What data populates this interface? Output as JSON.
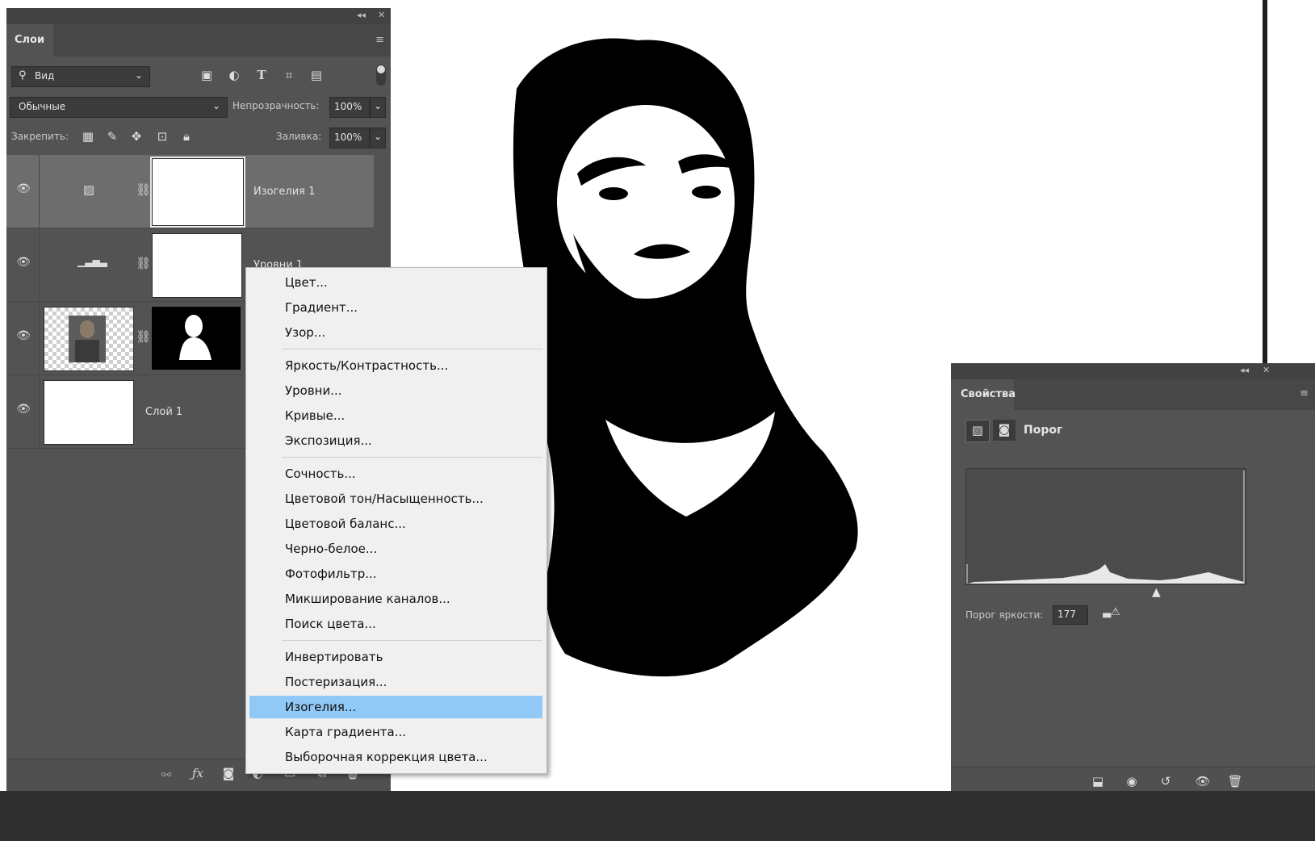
{
  "layers_panel": {
    "tab_label": "Слои",
    "filter_label": "Вид",
    "blend_mode": "Обычные",
    "opacity_label": "Непрозрачность:",
    "opacity_value": "100%",
    "lock_label": "Закрепить:",
    "fill_label": "Заливка:",
    "fill_value": "100%",
    "layers": [
      {
        "name": "Изогелия 1",
        "selected": true
      },
      {
        "name": "Уровни 1",
        "selected": false
      },
      {
        "name": "",
        "selected": false
      },
      {
        "name": "Слой 1",
        "selected": false
      }
    ]
  },
  "context_menu": {
    "groups": [
      [
        "Цвет...",
        "Градиент...",
        "Узор..."
      ],
      [
        "Яркость/Контрастность...",
        "Уровни...",
        "Кривые...",
        "Экспозиция..."
      ],
      [
        "Сочность...",
        "Цветовой тон/Насыщенность...",
        "Цветовой баланс...",
        "Черно-белое...",
        "Фотофильтр...",
        "Микширование каналов...",
        "Поиск цвета..."
      ],
      [
        "Инвертировать",
        "Постеризация...",
        "Изогелия...",
        "Карта градиента...",
        "Выборочная коррекция цвета..."
      ]
    ],
    "highlighted": "Изогелия...",
    "highlight_color": "#90c8f6"
  },
  "properties_panel": {
    "tab_label": "Свойства",
    "adjustment_name": "Порог",
    "threshold_label": "Порог яркости:",
    "threshold_value": "177"
  },
  "colors": {
    "panel_bg": "#535353",
    "panel_dark": "#424242",
    "canvas_bg": "#ffffff"
  },
  "icons": [
    "eye-icon",
    "search-icon",
    "chevron-down-icon",
    "link-icon",
    "fx-icon",
    "mask-icon",
    "trash-icon",
    "menu-icon",
    "collapse-icon",
    "close-icon",
    "lock-icon",
    "move-icon",
    "brush-icon"
  ]
}
